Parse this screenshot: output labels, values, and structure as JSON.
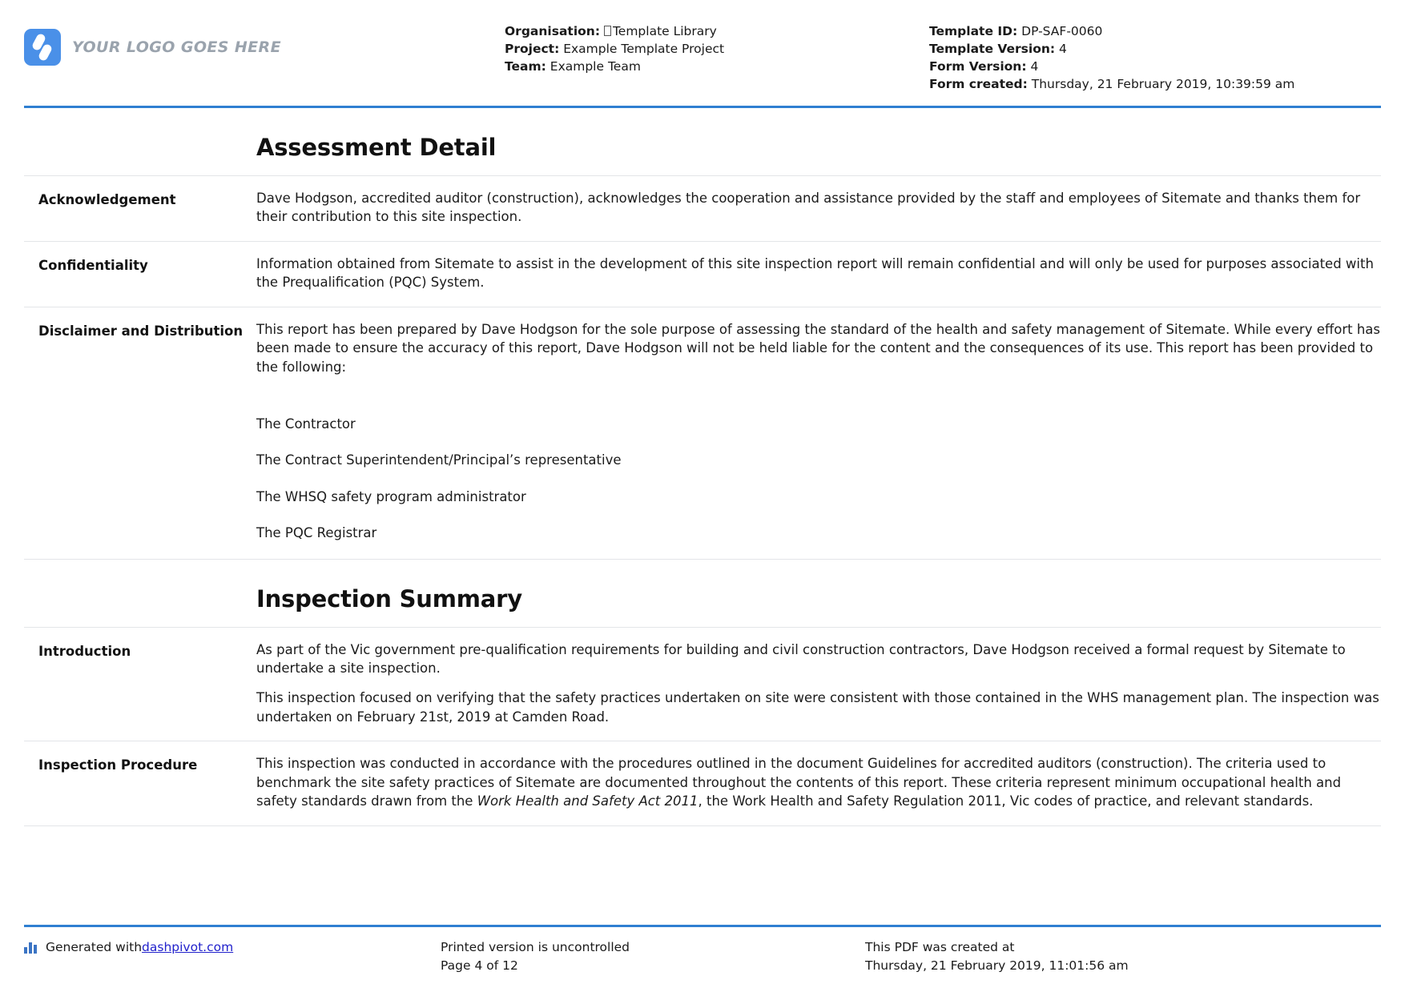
{
  "header": {
    "logo_text": "YOUR LOGO GOES HERE",
    "logo_icon": "sitemate-logo-icon",
    "organisation_label": "Organisation:",
    "organisation_value": "Template Library",
    "project_label": "Project:",
    "project_value": "Example Template Project",
    "team_label": "Team:",
    "team_value": "Example Team",
    "template_id_label": "Template ID:",
    "template_id_value": "DP-SAF-0060",
    "template_version_label": "Template Version:",
    "template_version_value": "4",
    "form_version_label": "Form Version:",
    "form_version_value": "4",
    "form_created_label": "Form created:",
    "form_created_value": "Thursday, 21 February 2019, 10:39:59 am"
  },
  "sections": [
    {
      "title": "Assessment Detail",
      "rows": [
        {
          "label": "Acknowledgement",
          "paragraphs": [
            "Dave Hodgson, accredited auditor (construction), acknowledges the cooperation and assistance provided by the staff and employees of Sitemate and thanks them for their contribution to this site inspection."
          ]
        },
        {
          "label": "Confidentiality",
          "paragraphs": [
            "Information obtained from Sitemate to assist in the development of this site inspection report will remain confidential and will only be used for purposes associated with the Prequalification (PQC) System."
          ]
        },
        {
          "label": "Disclaimer and Distribution",
          "paragraphs": [
            "This report has been prepared by Dave Hodgson for the sole purpose of assessing the standard of the health and safety management of Sitemate. While every effort has been made to ensure the accuracy of this report, Dave Hodgson will not be held liable for the content and the consequences of its use. This report has been provided to the following:"
          ],
          "distribution": [
            "The Contractor",
            "The Contract Superintendent/Principal’s representative",
            "The WHSQ safety program administrator",
            "The PQC Registrar"
          ]
        }
      ]
    },
    {
      "title": "Inspection Summary",
      "rows": [
        {
          "label": "Introduction",
          "paragraphs": [
            "As part of the Vic government pre-qualification requirements for building and civil construction contractors, Dave Hodgson received a formal request by Sitemate to undertake a site inspection.",
            "This inspection focused on verifying that the safety practices undertaken on site were consistent with those contained in the WHS management plan. The inspection was undertaken on February 21st, 2019 at Camden Road."
          ]
        },
        {
          "label": "Inspection Procedure",
          "rich": [
            {
              "text": "This inspection was conducted in accordance with the procedures outlined in the document Guidelines for accredited auditors (construction). The criteria used to benchmark the site safety practices of Sitemate are documented throughout the contents of this report. These criteria represent minimum occupational health and safety standards drawn from the ",
              "style": "normal"
            },
            {
              "text": "Work Health and Safety Act 2011",
              "style": "italic"
            },
            {
              "text": ", the Work Health and Safety Regulation 2011, Vic codes of practice, and relevant standards.",
              "style": "normal"
            }
          ]
        }
      ]
    }
  ],
  "footer": {
    "generated_prefix": "Generated with ",
    "generated_link": "dashpivot.com",
    "chart_icon": "bar-chart-icon",
    "printed_notice": "Printed version is uncontrolled",
    "page_number": "Page 4 of 12",
    "pdf_created_label": "This PDF was created at",
    "pdf_created_value": "Thursday, 21 February 2019, 11:01:56 am"
  },
  "colors": {
    "accent_blue": "#2f7fd1",
    "logo_blue": "#4a90e8",
    "link_blue": "#2222cc"
  }
}
